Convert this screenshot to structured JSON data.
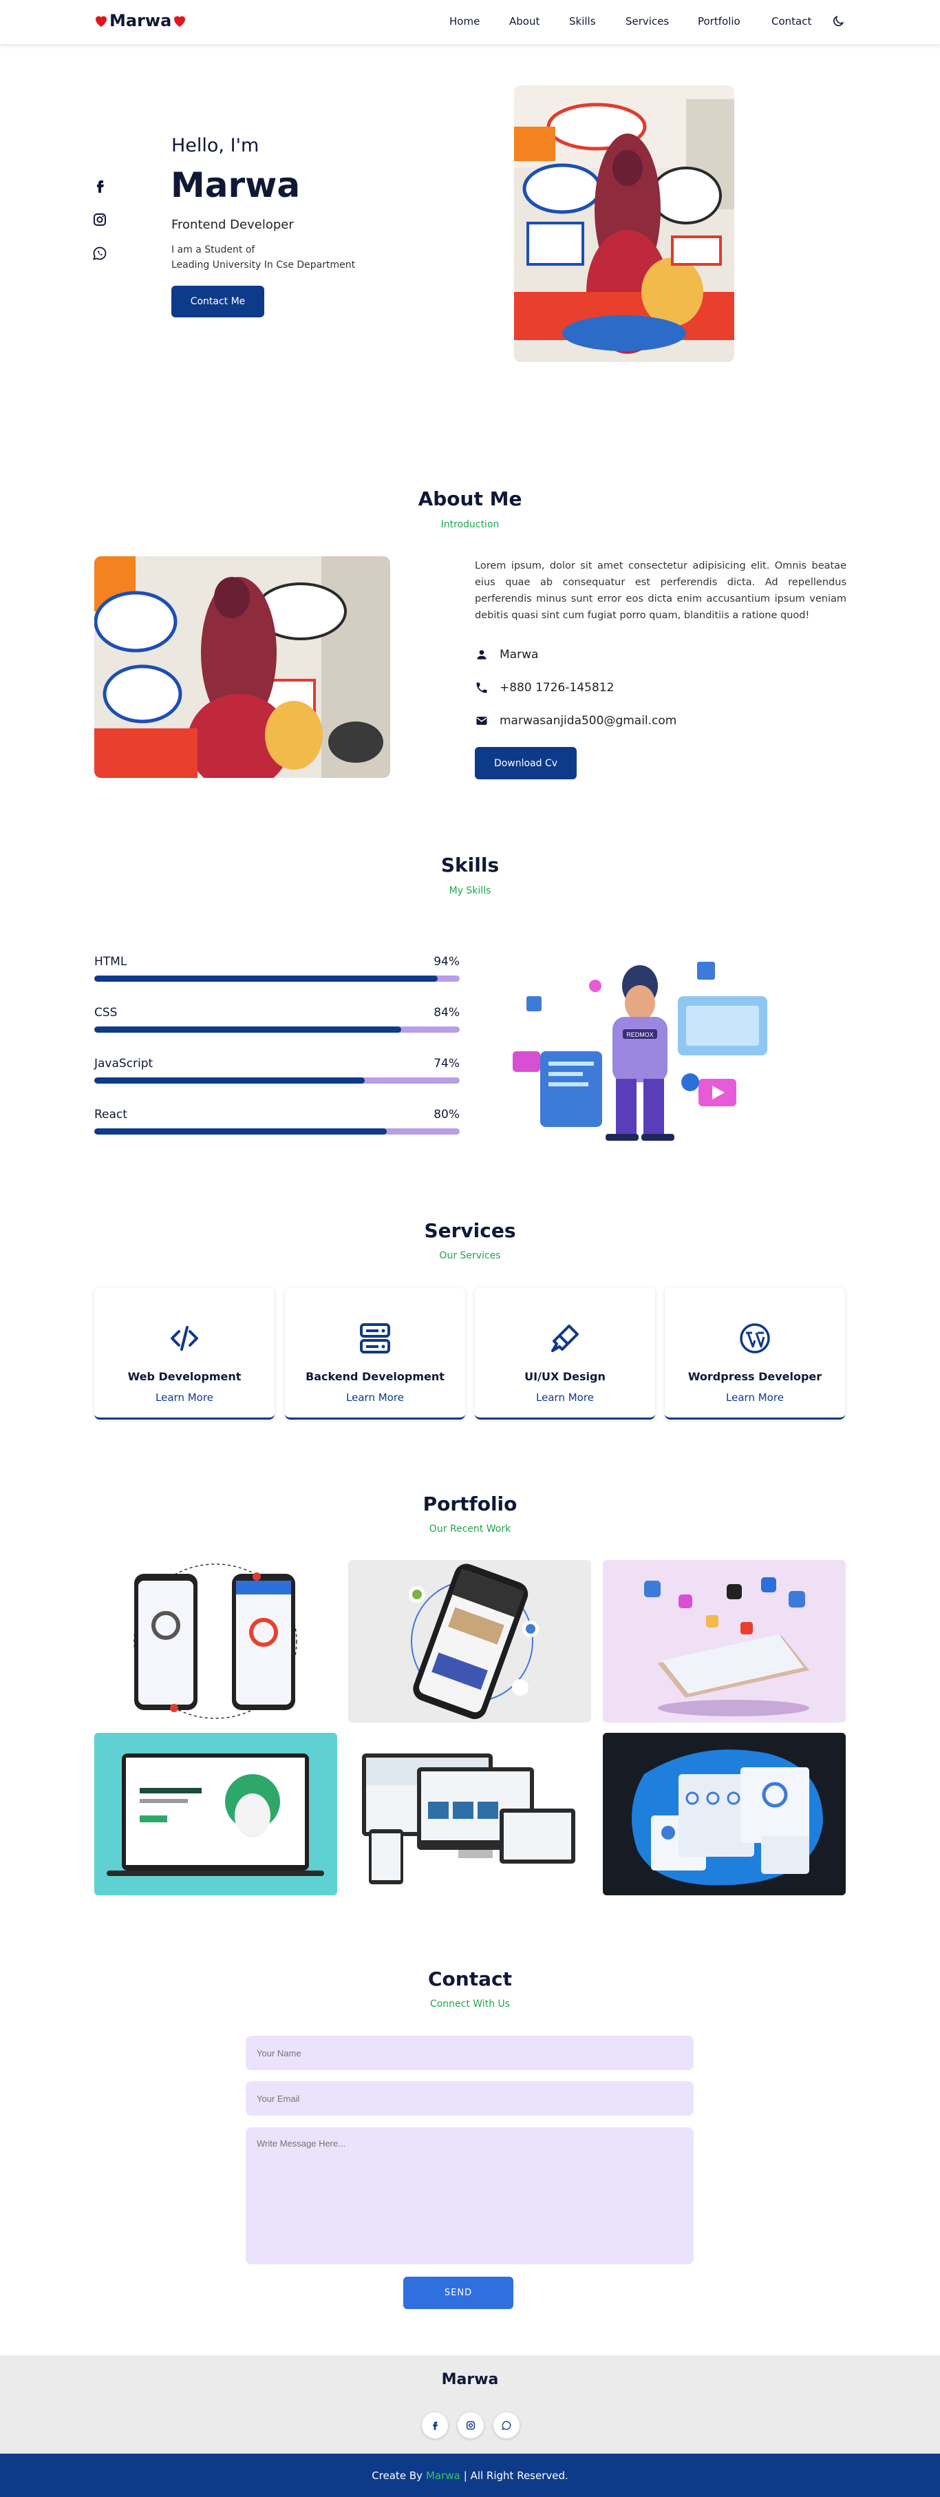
{
  "header": {
    "logo": "Marwa",
    "nav": [
      "Home",
      "About",
      "Skills",
      "Services",
      "Portfolio",
      "Contact"
    ]
  },
  "hero": {
    "greeting": "Hello, I'm",
    "name": "Marwa",
    "role": "Frontend Developer",
    "desc1": "I am a Student of",
    "desc2": "Leading University In Cse Department",
    "button": "Contact Me"
  },
  "about": {
    "title": "About Me",
    "subtitle": "Introduction",
    "text": "Lorem ipsum, dolor sit amet consectetur adipisicing elit. Omnis beatae eius quae ab consequatur est perferendis dicta. Ad repellendus perferendis minus sunt error eos dicta enim accusantium ipsum veniam debitis quasi sint cum fugiat porro quam, blanditiis a ratione quod!",
    "name": "Marwa",
    "phone": "+880 1726-145812",
    "email": "marwasanjida500@gmail.com",
    "button": "Download Cv"
  },
  "skills": {
    "title": "Skills",
    "subtitle": "My Skills",
    "items": [
      {
        "name": "HTML",
        "percent": "94%",
        "value": 94
      },
      {
        "name": "CSS",
        "percent": "84%",
        "value": 84
      },
      {
        "name": "JavaScript",
        "percent": "74%",
        "value": 74
      },
      {
        "name": "React",
        "percent": "80%",
        "value": 80
      }
    ],
    "illustration_label": "REDMOX"
  },
  "services": {
    "title": "Services",
    "subtitle": "Our Services",
    "items": [
      {
        "title": "Web Development",
        "link": "Learn More",
        "icon": "code-icon"
      },
      {
        "title": "Backend Development",
        "link": "Learn More",
        "icon": "server-icon"
      },
      {
        "title": "UI/UX Design",
        "link": "Learn More",
        "icon": "paint-brush-icon"
      },
      {
        "title": "Wordpress Developer",
        "link": "Learn More",
        "icon": "wordpress-icon"
      }
    ]
  },
  "portfolio": {
    "title": "Portfolio",
    "subtitle": "Our Recent Work"
  },
  "contact": {
    "title": "Contact",
    "subtitle": "Connect With Us",
    "name_placeholder": "Your Name",
    "email_placeholder": "Your Email",
    "message_placeholder": "Write Message Here...",
    "button": "SEND"
  },
  "footer": {
    "brand": "Marwa",
    "copy_prefix": "Create By",
    "copy_name": "Marwa",
    "copy_suffix": "| All Right Reserved."
  },
  "colors": {
    "primary": "#0e3a8a",
    "accent": "#1ea84a",
    "heart": "#e0161b",
    "field": "#ebe3fb",
    "send": "#2f6fe0"
  }
}
